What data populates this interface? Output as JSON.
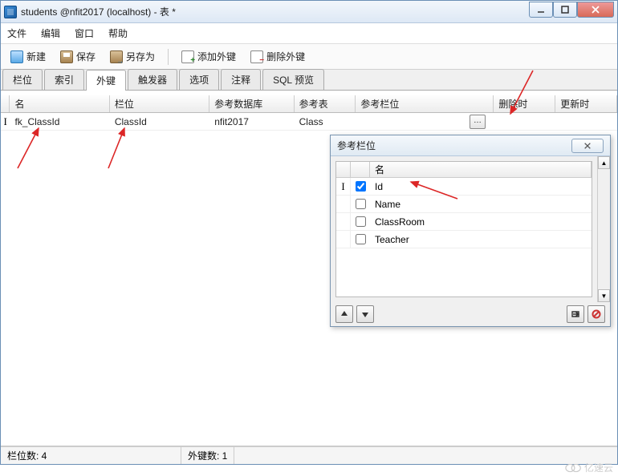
{
  "window": {
    "title": "students @nfit2017 (localhost) - 表 *"
  },
  "menubar": {
    "file": "文件",
    "edit": "编辑",
    "window": "窗口",
    "help": "帮助"
  },
  "toolbar": {
    "new": "新建",
    "save": "保存",
    "save_as": "另存为",
    "add_fk": "添加外键",
    "delete_fk": "删除外键"
  },
  "tabs": {
    "fields": "栏位",
    "indexes": "索引",
    "fk": "外键",
    "triggers": "触发器",
    "options": "选项",
    "comments": "注释",
    "sql": "SQL 预览"
  },
  "grid": {
    "headers": {
      "name": "名",
      "col": "栏位",
      "db": "参考数据库",
      "tbl": "参考表",
      "refcol": "参考栏位",
      "ondelete": "删除时",
      "onupdate": "更新时"
    },
    "rows": [
      {
        "name": "fk_ClassId",
        "col": "ClassId",
        "db": "nfit2017",
        "tbl": "Class",
        "refcol": "",
        "ondelete": "",
        "onupdate": ""
      }
    ]
  },
  "popup": {
    "title": "参考栏位",
    "header_name": "名",
    "items": [
      {
        "label": "Id",
        "checked": true,
        "cursor": true
      },
      {
        "label": "Name",
        "checked": false,
        "cursor": false
      },
      {
        "label": "ClassRoom",
        "checked": false,
        "cursor": false
      },
      {
        "label": "Teacher",
        "checked": false,
        "cursor": false
      }
    ]
  },
  "statusbar": {
    "fields_count": "栏位数: 4",
    "fk_count": "外键数: 1"
  },
  "watermark": "亿速云"
}
